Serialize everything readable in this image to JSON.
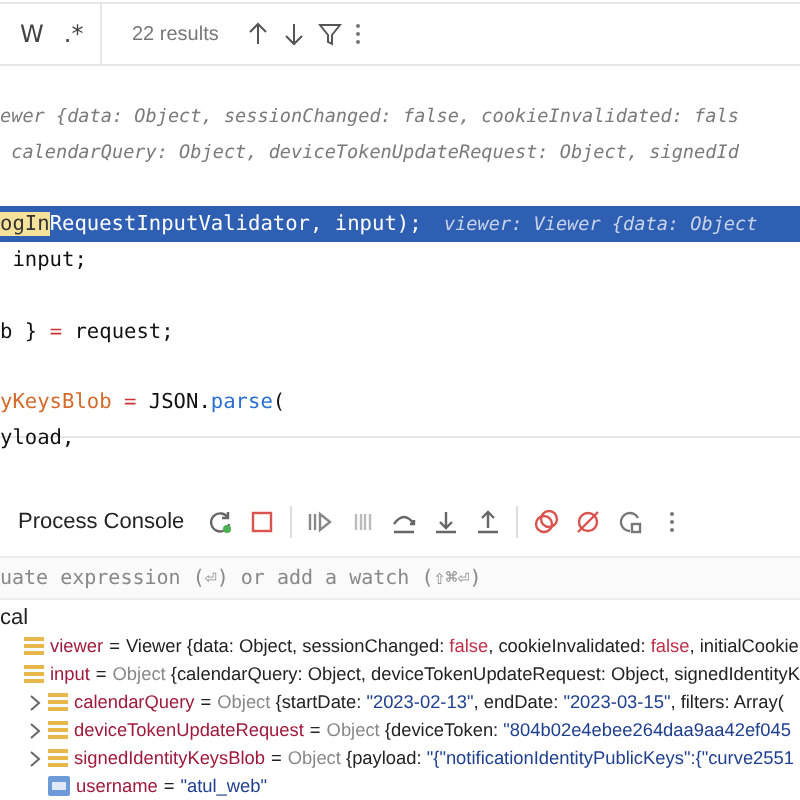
{
  "search_bar": {
    "options": [
      "W",
      ".*"
    ],
    "results": "22 results"
  },
  "editor": {
    "lines": [
      {
        "kind": "code",
        "selected": false,
        "segments": [
          {
            "kind": "hint",
            "text": "ewer {data: Object, sessionChanged: false, cookieInvalidated: fals"
          }
        ]
      },
      {
        "kind": "code",
        "selected": false,
        "segments": [
          {
            "kind": "hint",
            "text": " calendarQuery: Object, deviceTokenUpdateRequest: Object, signedId"
          }
        ]
      },
      {
        "kind": "blank"
      },
      {
        "kind": "code",
        "selected": true,
        "segments": [
          {
            "kind": "match",
            "text": "ogIn"
          },
          {
            "kind": "plain",
            "text": "RequestInputValidator, input);"
          },
          {
            "kind": "hint",
            "text": "  viewer: Viewer {data: Object"
          }
        ]
      },
      {
        "kind": "code",
        "selected": false,
        "segments": [
          {
            "kind": "plain",
            "text": " input;"
          }
        ]
      },
      {
        "kind": "blank"
      },
      {
        "kind": "code",
        "selected": false,
        "segments": [
          {
            "kind": "plain",
            "text": "b } "
          },
          {
            "kind": "op",
            "text": "="
          },
          {
            "kind": "plain",
            "text": " request;"
          }
        ]
      },
      {
        "kind": "blank"
      },
      {
        "kind": "code",
        "selected": false,
        "segments": [
          {
            "kind": "var",
            "text": "yKeysBlob"
          },
          {
            "kind": "op",
            "text": " = "
          },
          {
            "kind": "plain",
            "text": "JSON."
          },
          {
            "kind": "method",
            "text": "parse"
          },
          {
            "kind": "plain",
            "text": "("
          }
        ]
      },
      {
        "kind": "code",
        "selected": false,
        "segments": [
          {
            "kind": "plain",
            "text": "yload,"
          }
        ]
      }
    ]
  },
  "debug_toolbar": {
    "title": "Process Console",
    "buttons": [
      {
        "kind": "rerun"
      },
      {
        "kind": "stop"
      },
      {
        "kind": "sep"
      },
      {
        "kind": "resume"
      },
      {
        "kind": "pause"
      },
      {
        "kind": "step-over"
      },
      {
        "kind": "step-into"
      },
      {
        "kind": "step-out"
      },
      {
        "kind": "sep"
      },
      {
        "kind": "breakpoints"
      },
      {
        "kind": "mute"
      },
      {
        "kind": "restart-frame"
      },
      {
        "kind": "more"
      }
    ]
  },
  "evaluate": {
    "placeholder": "uate expression (⏎) or add a watch (⇧⌘⏎)"
  },
  "variables": {
    "scope": "cal",
    "items": [
      {
        "kind": "object",
        "expandable": false,
        "name": "viewer",
        "operator": "=",
        "value": [
          {
            "kind": "plain",
            "text": "Viewer {data: Object, sessionChanged: "
          },
          {
            "kind": "keyword",
            "text": "false"
          },
          {
            "kind": "plain",
            "text": ", cookieInvalidated: "
          },
          {
            "kind": "keyword",
            "text": "false"
          },
          {
            "kind": "plain",
            "text": ", initialCookie"
          }
        ]
      },
      {
        "kind": "object",
        "expandable": false,
        "name": "input",
        "operator": "=",
        "value": [
          {
            "kind": "type",
            "text": "Object "
          },
          {
            "kind": "plain",
            "text": "{calendarQuery: Object, deviceTokenUpdateRequest: Object, signedIdentityK"
          }
        ],
        "children": [
          {
            "kind": "object",
            "expandable": true,
            "name": "calendarQuery",
            "operator": "=",
            "value": [
              {
                "kind": "type",
                "text": "Object "
              },
              {
                "kind": "plain",
                "text": "{startDate: "
              },
              {
                "kind": "string",
                "text": "\"2023-02-13\""
              },
              {
                "kind": "plain",
                "text": ", endDate: "
              },
              {
                "kind": "string",
                "text": "\"2023-03-15\""
              },
              {
                "kind": "plain",
                "text": ", filters: Array("
              }
            ]
          },
          {
            "kind": "object",
            "expandable": true,
            "name": "deviceTokenUpdateRequest",
            "operator": "=",
            "value": [
              {
                "kind": "type",
                "text": "Object "
              },
              {
                "kind": "plain",
                "text": "{deviceToken: "
              },
              {
                "kind": "string",
                "text": "\"804b02e4ebee264daa9aa42ef045"
              }
            ]
          },
          {
            "kind": "object",
            "expandable": true,
            "name": "signedIdentityKeysBlob",
            "operator": "=",
            "value": [
              {
                "kind": "type",
                "text": "Object "
              },
              {
                "kind": "plain",
                "text": "{payload: "
              },
              {
                "kind": "string",
                "text": "\"{\"notificationIdentityPublicKeys\":{\"curve2551"
              }
            ]
          },
          {
            "kind": "primitive",
            "expandable": false,
            "name": "username",
            "operator": "=",
            "value": [
              {
                "kind": "string",
                "text": "\"atul_web\""
              }
            ]
          }
        ]
      }
    ]
  }
}
